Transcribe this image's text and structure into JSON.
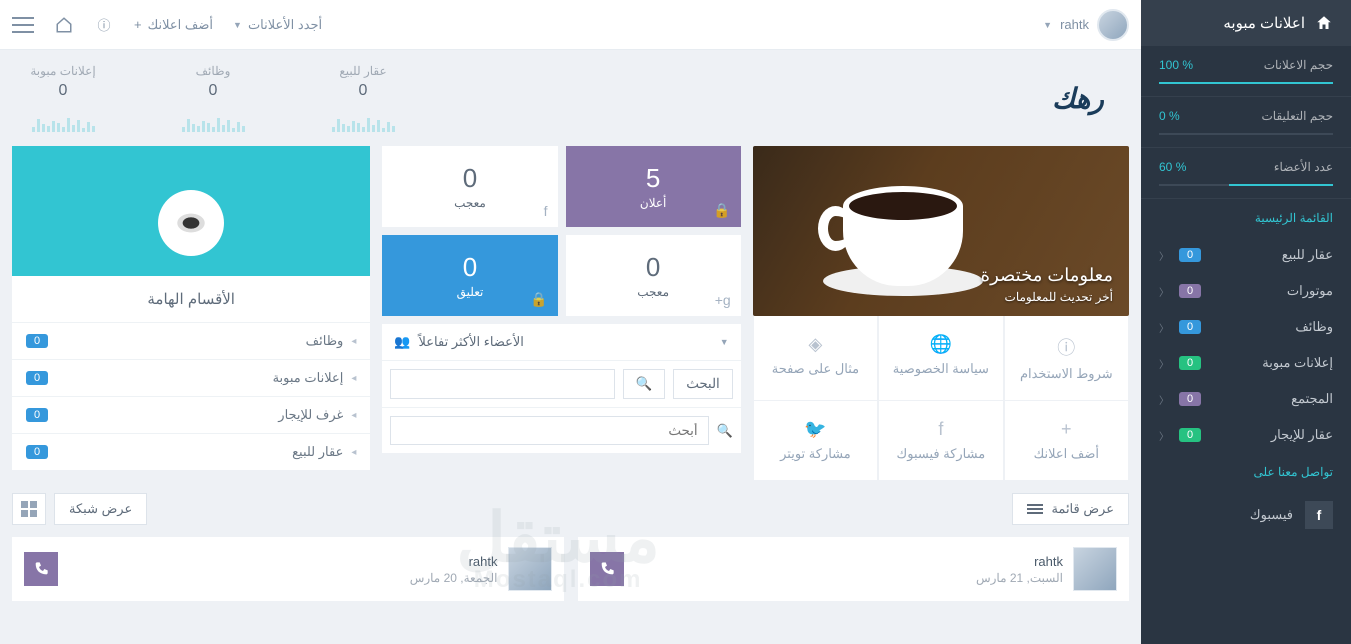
{
  "sidebar": {
    "title": "اعلانات مبوبه",
    "stats": [
      {
        "label": "حجم الاعلانات",
        "pct": "% 100",
        "cls": "w100"
      },
      {
        "label": "حجم التعليقات",
        "pct": "% 0",
        "cls": "w0"
      },
      {
        "label": "عدد الأعضاء",
        "pct": "% 60",
        "cls": "w60"
      }
    ],
    "menu_heading": "القائمة الرئيسية",
    "items": [
      {
        "label": "عقار للبيع",
        "badge": "0",
        "bcls": "b-blue"
      },
      {
        "label": "موتورات",
        "badge": "0",
        "bcls": "b-purple"
      },
      {
        "label": "وظائف",
        "badge": "0",
        "bcls": "b-blue"
      },
      {
        "label": "إعلانات مبوبة",
        "badge": "0",
        "bcls": "b-green"
      },
      {
        "label": "المجتمع",
        "badge": "0",
        "bcls": "b-purple"
      },
      {
        "label": "عقار للإيجار",
        "badge": "0",
        "bcls": "b-green"
      }
    ],
    "social_heading": "تواصل معنا على",
    "social": {
      "label": "فيسبوك",
      "icon": "f"
    }
  },
  "topbar": {
    "user": "rahtk",
    "latest": "أجدد الأعلانات",
    "add": "أضف اعلانك"
  },
  "topstats": [
    {
      "label": "عقار للبيع",
      "val": "0"
    },
    {
      "label": "وظائف",
      "val": "0"
    },
    {
      "label": "إعلانات مبوبة",
      "val": "0"
    }
  ],
  "logo": "رهك",
  "hero": {
    "title": "معلومات مختصرة",
    "sub": "أخر تحديث للمعلومات"
  },
  "quick": [
    {
      "label": "شروط الاستخدام"
    },
    {
      "label": "سياسة الخصوصية"
    },
    {
      "label": "مثال على صفحة"
    },
    {
      "label": "أضف اعلانك"
    },
    {
      "label": "مشاركة فيسبوك"
    },
    {
      "label": "مشاركة تويتر"
    }
  ],
  "tiles": [
    {
      "num": "5",
      "lab": "أعلان",
      "cls": "purple",
      "corner": "🔒"
    },
    {
      "num": "0",
      "lab": "معجب",
      "cls": "white",
      "corner": "f"
    },
    {
      "num": "0",
      "lab": "معجب",
      "cls": "white",
      "corner": "g+"
    },
    {
      "num": "0",
      "lab": "تعليق",
      "cls": "blue",
      "corner": "🔒"
    }
  ],
  "members_panel": {
    "title": "الأعضاء الأكثر تفاعلاً",
    "search_btn": "البحث",
    "filter_placeholder": "أبحث"
  },
  "categories": {
    "title": "الأقسام الهامة",
    "items": [
      {
        "label": "وظائف",
        "badge": "0"
      },
      {
        "label": "إعلانات مبوبة",
        "badge": "0"
      },
      {
        "label": "غرف للإيجار",
        "badge": "0"
      },
      {
        "label": "عقار للبيع",
        "badge": "0"
      }
    ]
  },
  "views": {
    "list": "عرض قائمة",
    "grid": "عرض شبكة"
  },
  "posts": [
    {
      "author": "rahtk",
      "date": "السبت, 21 مارس"
    },
    {
      "author": "rahtk",
      "date": "الجمعة, 20 مارس"
    }
  ],
  "watermark": {
    "main": "مستقل",
    "sub": "Mostaql.com"
  }
}
